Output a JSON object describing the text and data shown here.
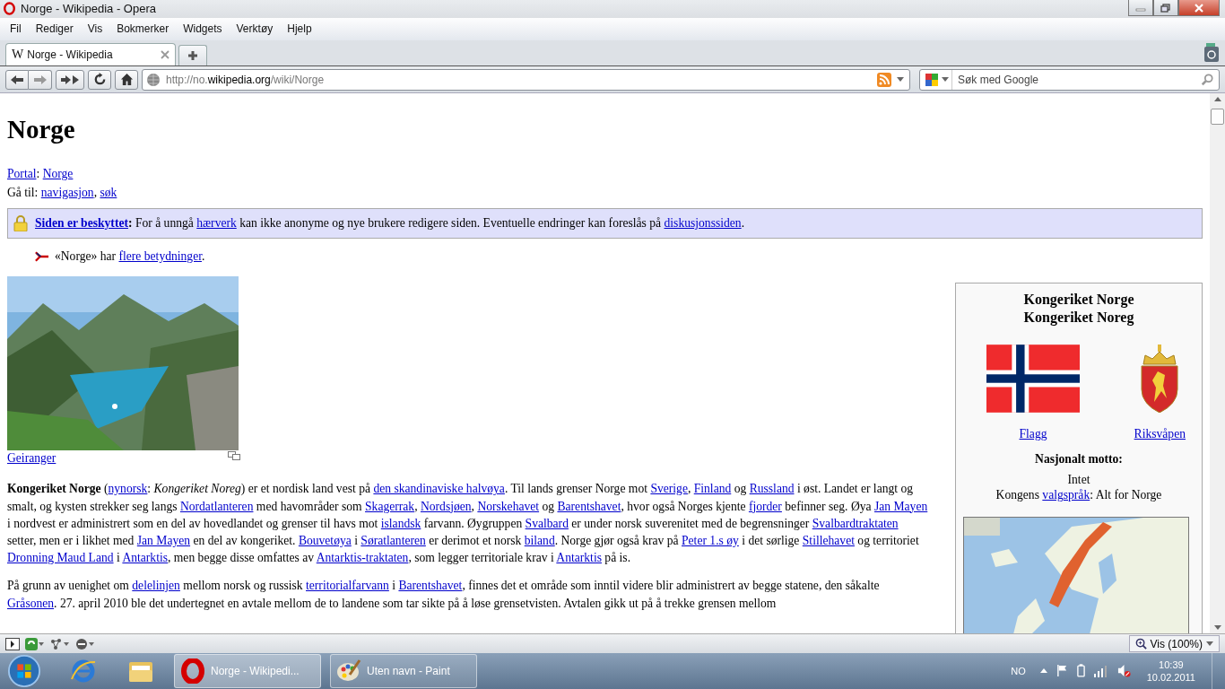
{
  "window": {
    "title": "Norge - Wikipedia - Opera"
  },
  "menu": [
    "Fil",
    "Rediger",
    "Vis",
    "Bokmerker",
    "Widgets",
    "Verktøy",
    "Hjelp"
  ],
  "tabs": [
    {
      "favicon": "W",
      "label": "Norge - Wikipedia",
      "selected": true
    }
  ],
  "address_bar": {
    "prefix": "http://no.",
    "domain": "wikipedia.org",
    "path": "/wiki/Norge"
  },
  "search": {
    "placeholder": "Søk med Google"
  },
  "page": {
    "title": "Norge",
    "portal": [
      {
        "kind": "link",
        "text": "Portal"
      },
      {
        "kind": "text",
        "text": ": "
      },
      {
        "kind": "link",
        "text": "Norge"
      }
    ],
    "goto": [
      {
        "kind": "text",
        "text": "Gå til: "
      },
      {
        "kind": "link",
        "text": "navigasjon"
      },
      {
        "kind": "text",
        "text": ", "
      },
      {
        "kind": "link",
        "text": "søk"
      }
    ],
    "notice": [
      {
        "kind": "boldlink",
        "text": "Siden er beskyttet"
      },
      {
        "kind": "bold",
        "text": ":"
      },
      {
        "kind": "text",
        "text": " For å unngå "
      },
      {
        "kind": "link",
        "text": "hærverk"
      },
      {
        "kind": "text",
        "text": " kan ikke anonyme og nye brukere redigere siden. Eventuelle endringer kan foreslås på "
      },
      {
        "kind": "link",
        "text": "diskusjonssiden"
      },
      {
        "kind": "text",
        "text": "."
      }
    ],
    "disambiguation": [
      {
        "kind": "text",
        "text": "«Norge» har "
      },
      {
        "kind": "link",
        "text": "flere betydninger"
      },
      {
        "kind": "text",
        "text": "."
      }
    ],
    "image_caption": "Geiranger",
    "paragraphs": [
      [
        {
          "kind": "bold",
          "text": "Kongeriket Norge"
        },
        {
          "kind": "text",
          "text": " ("
        },
        {
          "kind": "link",
          "text": "nynorsk"
        },
        {
          "kind": "text",
          "text": ": "
        },
        {
          "kind": "italic",
          "text": "Kongeriket Noreg"
        },
        {
          "kind": "text",
          "text": ") er et nordisk land vest på "
        },
        {
          "kind": "link",
          "text": "den skandinaviske halvøya"
        },
        {
          "kind": "text",
          "text": ". Til lands grenser Norge mot "
        },
        {
          "kind": "link",
          "text": "Sverige"
        },
        {
          "kind": "text",
          "text": ", "
        },
        {
          "kind": "link",
          "text": "Finland"
        },
        {
          "kind": "text",
          "text": " og "
        },
        {
          "kind": "link",
          "text": "Russland"
        },
        {
          "kind": "text",
          "text": " i øst. Landet er langt og smalt, og kysten strekker seg langs "
        },
        {
          "kind": "link",
          "text": "Nordatlanteren"
        },
        {
          "kind": "text",
          "text": " med havområder som "
        },
        {
          "kind": "link",
          "text": "Skagerrak"
        },
        {
          "kind": "text",
          "text": ", "
        },
        {
          "kind": "link",
          "text": "Nordsjøen"
        },
        {
          "kind": "text",
          "text": ", "
        },
        {
          "kind": "link",
          "text": "Norskehavet"
        },
        {
          "kind": "text",
          "text": " og "
        },
        {
          "kind": "link",
          "text": "Barentshavet"
        },
        {
          "kind": "text",
          "text": ", hvor også Norges kjente "
        },
        {
          "kind": "link",
          "text": "fjorder"
        },
        {
          "kind": "text",
          "text": " befinner seg. Øya "
        },
        {
          "kind": "link",
          "text": "Jan Mayen"
        },
        {
          "kind": "text",
          "text": " i nordvest er administrert som en del av hovedlandet og grenser til havs mot "
        },
        {
          "kind": "link",
          "text": "islandsk"
        },
        {
          "kind": "text",
          "text": " farvann. Øygruppen "
        },
        {
          "kind": "link",
          "text": "Svalbard"
        },
        {
          "kind": "text",
          "text": " er under norsk suverenitet med de begrensninger "
        },
        {
          "kind": "link",
          "text": "Svalbardtraktaten"
        },
        {
          "kind": "text",
          "text": " setter, men er i likhet med "
        },
        {
          "kind": "link",
          "text": "Jan Mayen"
        },
        {
          "kind": "text",
          "text": " en del av kongeriket. "
        },
        {
          "kind": "link",
          "text": "Bouvetøya"
        },
        {
          "kind": "text",
          "text": " i "
        },
        {
          "kind": "link",
          "text": "Søratlanteren"
        },
        {
          "kind": "text",
          "text": " er derimot et norsk "
        },
        {
          "kind": "link",
          "text": "biland"
        },
        {
          "kind": "text",
          "text": ". Norge gjør også krav på "
        },
        {
          "kind": "link",
          "text": "Peter 1.s øy"
        },
        {
          "kind": "text",
          "text": " i det sørlige "
        },
        {
          "kind": "link",
          "text": "Stillehavet"
        },
        {
          "kind": "text",
          "text": " og territoriet "
        },
        {
          "kind": "link",
          "text": "Dronning Maud Land"
        },
        {
          "kind": "text",
          "text": " i "
        },
        {
          "kind": "link",
          "text": "Antarktis"
        },
        {
          "kind": "text",
          "text": ", men begge disse omfattes av "
        },
        {
          "kind": "link",
          "text": "Antarktis-traktaten"
        },
        {
          "kind": "text",
          "text": ", som legger territoriale krav i "
        },
        {
          "kind": "link",
          "text": "Antarktis"
        },
        {
          "kind": "text",
          "text": " på is."
        }
      ],
      [
        {
          "kind": "text",
          "text": "På grunn av uenighet om "
        },
        {
          "kind": "link",
          "text": "delelinjen"
        },
        {
          "kind": "text",
          "text": " mellom norsk og russisk "
        },
        {
          "kind": "link",
          "text": "territorialfarvann"
        },
        {
          "kind": "text",
          "text": " i "
        },
        {
          "kind": "link",
          "text": "Barentshavet"
        },
        {
          "kind": "text",
          "text": ", finnes det et område som inntil videre blir administrert av begge statene, den såkalte "
        },
        {
          "kind": "link",
          "text": "Gråsonen"
        },
        {
          "kind": "text",
          "text": ". 27. april 2010 ble det undertegnet en avtale mellom de to landene som tar sikte på å løse grensetvisten. Avtalen gikk ut på å trekke grensen mellom"
        }
      ]
    ],
    "infobox": {
      "titles": [
        "Kongeriket Norge",
        "Kongeriket Noreg"
      ],
      "flag_caption": "Flagg",
      "arms_caption": "Riksvåpen",
      "motto_heading": "Nasjonalt motto:",
      "motto": "Intet",
      "royal_motto": [
        {
          "kind": "text",
          "text": "Kongens "
        },
        {
          "kind": "link",
          "text": "valgspråk"
        },
        {
          "kind": "text",
          "text": ": Alt for Norge"
        }
      ]
    }
  },
  "status_bar": {
    "zoom": "Vis (100%)"
  },
  "taskbar": {
    "tasks": [
      {
        "label": "Norge - Wikipedi...",
        "kind": "opera",
        "selected": true
      },
      {
        "label": "Uten navn - Paint",
        "kind": "paint",
        "selected": false
      }
    ],
    "language": "NO",
    "time": "10:39",
    "date": "10.02.2011"
  }
}
